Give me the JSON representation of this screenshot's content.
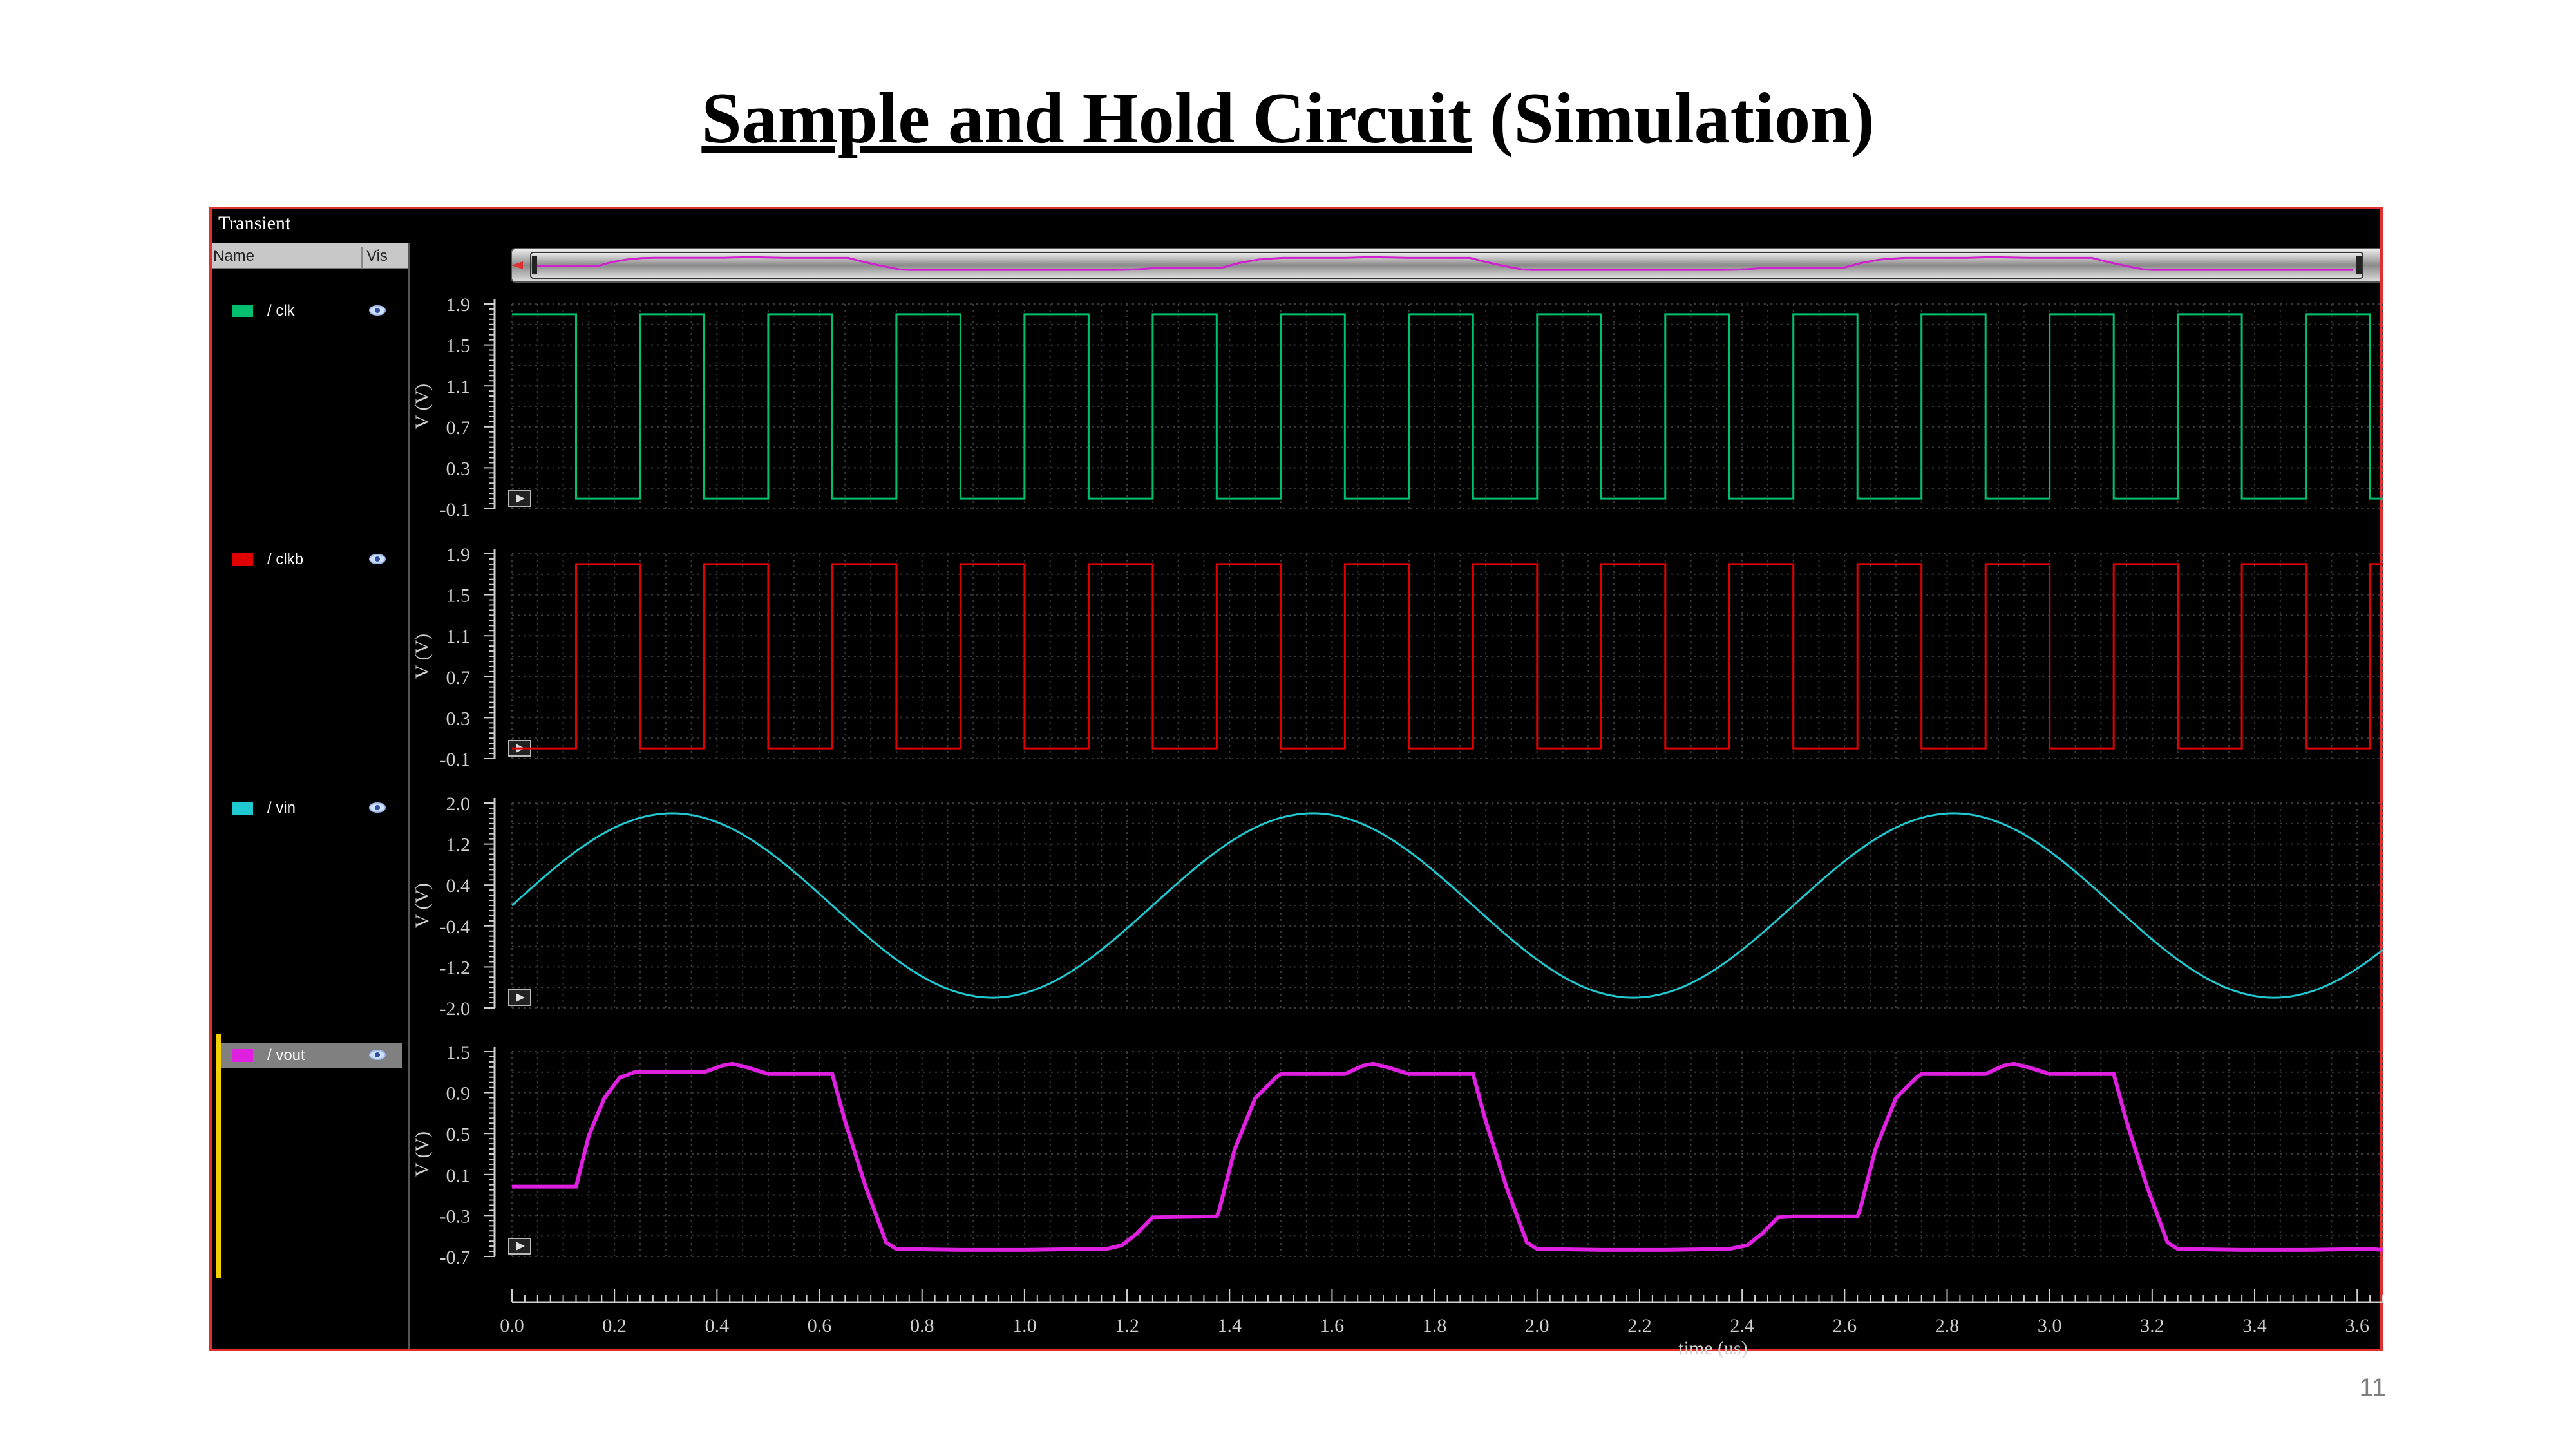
{
  "slide": {
    "title_underlined": "Sample and Hold Circuit",
    "title_suffix": " (Simulation)",
    "page_number": "11"
  },
  "viewer": {
    "title": "Transient",
    "name_header": "Name",
    "vis_header": "Vis",
    "colors": {
      "background": "#000000",
      "frame": "#e03030",
      "clk": "#00c070",
      "clkb": "#e00000",
      "vin": "#20c8d0",
      "vout": "#e020e0",
      "axis": "#d0d0d0",
      "grid": "#3a3a3a"
    },
    "signals": [
      {
        "label": "/ clk",
        "color": "#00c070",
        "icon": "eye-icon"
      },
      {
        "label": "/ clkb",
        "color": "#e00000",
        "icon": "eye-icon"
      },
      {
        "label": "/ vin",
        "color": "#20c8d0",
        "icon": "eye-icon"
      },
      {
        "label": "/ vout",
        "color": "#e020e0",
        "icon": "eye-icon",
        "selected": true
      }
    ]
  },
  "chart_data": {
    "type": "line",
    "xlabel": "time (us)",
    "xlim": [
      0.0,
      3.65
    ],
    "x_ticks": [
      "0.0",
      "0.2",
      "0.4",
      "0.6",
      "0.8",
      "1.0",
      "1.2",
      "1.4",
      "1.6",
      "1.8",
      "2.0",
      "2.2",
      "2.4",
      "2.6",
      "2.8",
      "3.0",
      "3.2",
      "3.4",
      "3.6"
    ],
    "grid": true,
    "panels": [
      {
        "name": "/clk",
        "ylabel": "V (V)",
        "ylim": [
          -0.1,
          1.9
        ],
        "y_ticks": [
          "1.9",
          "1.5",
          "1.1",
          "0.7",
          "0.3",
          "-0.1"
        ],
        "waveform": "square",
        "high": 1.8,
        "low": 0.0,
        "period_us": 0.25,
        "high_intervals_start_us": 0.0,
        "high_duration_us": 0.125
      },
      {
        "name": "/clkb",
        "ylabel": "V (V)",
        "ylim": [
          -0.1,
          1.9
        ],
        "y_ticks": [
          "1.9",
          "1.5",
          "1.1",
          "0.7",
          "0.3",
          "-0.1"
        ],
        "waveform": "square",
        "high": 1.8,
        "low": 0.0,
        "period_us": 0.25,
        "high_intervals_start_us": 0.125,
        "high_duration_us": 0.125
      },
      {
        "name": "/vin",
        "ylabel": "V (V)",
        "ylim": [
          -2.0,
          2.0
        ],
        "y_ticks": [
          "2.0",
          "1.2",
          "0.4",
          "-0.4",
          "-1.2",
          "-2.0"
        ],
        "waveform": "sine",
        "amplitude": 1.8,
        "offset": 0.0,
        "period_us": 1.25
      },
      {
        "name": "/vout",
        "ylabel": "V (V)",
        "ylim": [
          -0.7,
          1.5
        ],
        "y_ticks": [
          "1.5",
          "0.9",
          "0.5",
          "0.1",
          "-0.3",
          "-0.7"
        ],
        "waveform": "points",
        "x": [
          0.0,
          0.125,
          0.15,
          0.18,
          0.21,
          0.24,
          0.25,
          0.375,
          0.41,
          0.43,
          0.46,
          0.5,
          0.625,
          0.65,
          0.69,
          0.73,
          0.75,
          0.875,
          1.0,
          1.125,
          1.16,
          1.19,
          1.22,
          1.25,
          1.375,
          1.38,
          1.41,
          1.45,
          1.49,
          1.5,
          1.625,
          1.66,
          1.68,
          1.71,
          1.75,
          1.875,
          1.9,
          1.94,
          1.98,
          2.0,
          2.125,
          2.25,
          2.375,
          2.41,
          2.44,
          2.47,
          2.5,
          2.625,
          2.63,
          2.66,
          2.7,
          2.74,
          2.75,
          2.875,
          2.91,
          2.93,
          2.96,
          3.0,
          3.125,
          3.15,
          3.19,
          3.23,
          3.25,
          3.375,
          3.5,
          3.625,
          3.65
        ],
        "y": [
          0.05,
          0.05,
          0.6,
          1.0,
          1.22,
          1.28,
          1.28,
          1.28,
          1.35,
          1.37,
          1.33,
          1.26,
          1.26,
          0.75,
          0.05,
          -0.55,
          -0.62,
          -0.63,
          -0.63,
          -0.62,
          -0.62,
          -0.58,
          -0.45,
          -0.28,
          -0.27,
          -0.2,
          0.45,
          1.0,
          1.22,
          1.26,
          1.26,
          1.35,
          1.37,
          1.33,
          1.26,
          1.26,
          0.75,
          0.05,
          -0.55,
          -0.62,
          -0.63,
          -0.63,
          -0.62,
          -0.58,
          -0.45,
          -0.28,
          -0.27,
          -0.27,
          -0.2,
          0.45,
          1.0,
          1.22,
          1.26,
          1.26,
          1.35,
          1.37,
          1.33,
          1.26,
          1.26,
          0.75,
          0.05,
          -0.55,
          -0.62,
          -0.63,
          -0.63,
          -0.62,
          -0.63
        ]
      }
    ]
  }
}
